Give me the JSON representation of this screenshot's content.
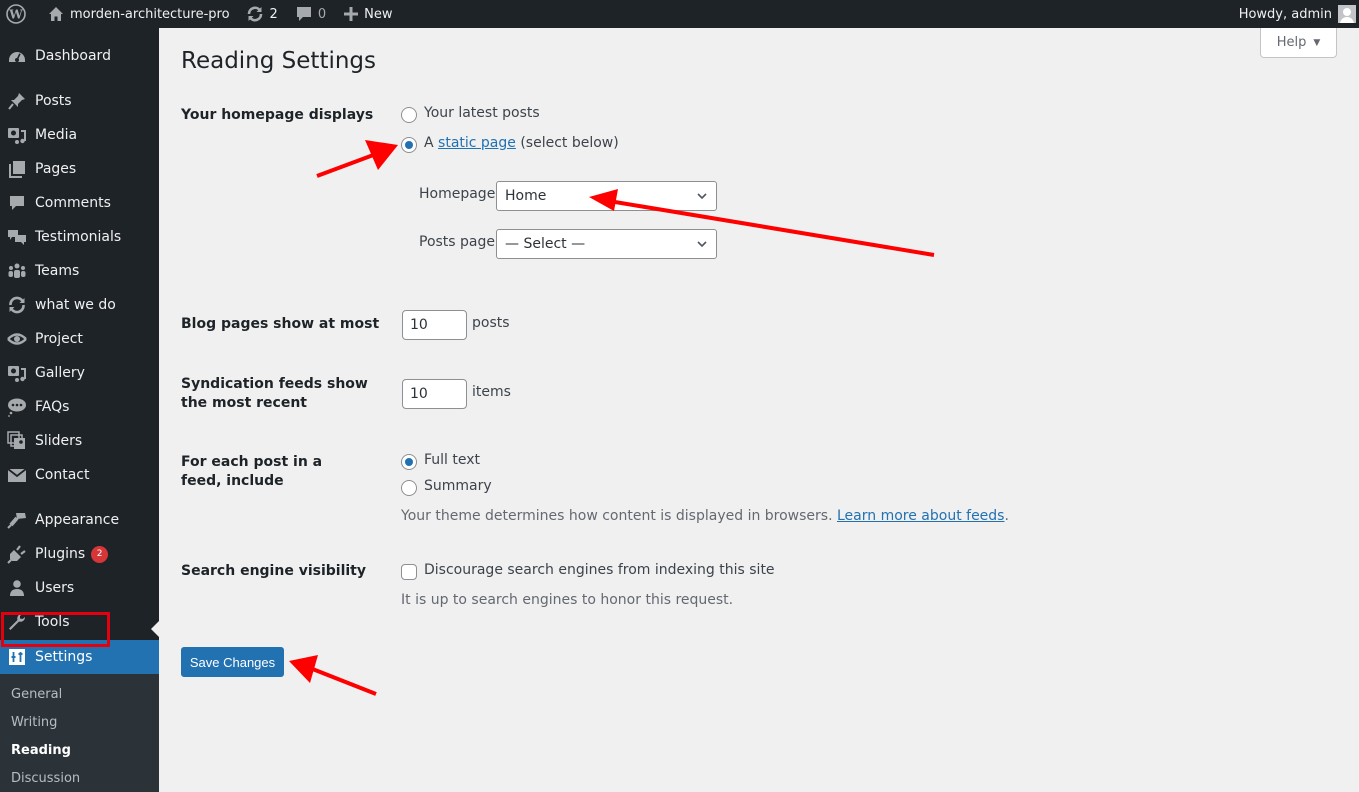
{
  "admin_bar": {
    "site_name": "morden-architecture-pro",
    "updates_count": "2",
    "comments_count": "0",
    "new_label": "New",
    "greeting": "Howdy, admin"
  },
  "help": {
    "label": "Help"
  },
  "sidebar": {
    "items": [
      {
        "label": "Dashboard",
        "icon": "dashboard-icon"
      },
      {
        "label": "Posts",
        "icon": "pin-icon"
      },
      {
        "label": "Media",
        "icon": "media-icon"
      },
      {
        "label": "Pages",
        "icon": "pages-icon"
      },
      {
        "label": "Comments",
        "icon": "comment-icon"
      },
      {
        "label": "Testimonials",
        "icon": "testimonials-icon"
      },
      {
        "label": "Teams",
        "icon": "groups-icon"
      },
      {
        "label": "what we do",
        "icon": "update-icon"
      },
      {
        "label": "Project",
        "icon": "visibility-icon"
      },
      {
        "label": "Gallery",
        "icon": "media-icon"
      },
      {
        "label": "FAQs",
        "icon": "chat-bubble-icon"
      },
      {
        "label": "Sliders",
        "icon": "images-icon"
      },
      {
        "label": "Contact",
        "icon": "email-icon"
      },
      {
        "label": "Appearance",
        "icon": "brush-icon"
      },
      {
        "label": "Plugins",
        "icon": "plugin-icon",
        "badge": "2"
      },
      {
        "label": "Users",
        "icon": "user-icon"
      },
      {
        "label": "Tools",
        "icon": "wrench-icon"
      },
      {
        "label": "Settings",
        "icon": "settings-icon",
        "active": true
      }
    ],
    "submenu": [
      {
        "label": "General"
      },
      {
        "label": "Writing"
      },
      {
        "label": "Reading",
        "current": true
      },
      {
        "label": "Discussion"
      }
    ]
  },
  "page": {
    "title": "Reading Settings",
    "homepage_displays": {
      "label": "Your homepage displays",
      "option_latest": "Your latest posts",
      "option_static_prefix": "A",
      "option_static_link": "static page",
      "option_static_suffix": "(select below)",
      "selected": "static",
      "homepage_label": "Homepage:",
      "homepage_value": "Home",
      "posts_page_label": "Posts page:",
      "posts_page_value": "— Select —"
    },
    "blog_pages": {
      "label": "Blog pages show at most",
      "value": "10",
      "unit": "posts"
    },
    "syndication": {
      "label": "Syndication feeds show the most recent",
      "value": "10",
      "unit": "items"
    },
    "feed_content": {
      "label": "For each post in a feed, include",
      "option_full": "Full text",
      "option_summary": "Summary",
      "selected": "full",
      "description": "Your theme determines how content is displayed in browsers.",
      "link": "Learn more about feeds",
      "after_link": "."
    },
    "search_visibility": {
      "label": "Search engine visibility",
      "checkbox_label": "Discourage search engines from indexing this site",
      "checked": false,
      "description": "It is up to search engines to honor this request."
    },
    "save_label": "Save Changes"
  },
  "colors": {
    "admin_bg": "#1d2327",
    "accent": "#2271b1",
    "annotation": "#e3000f",
    "badge": "#d63638"
  }
}
